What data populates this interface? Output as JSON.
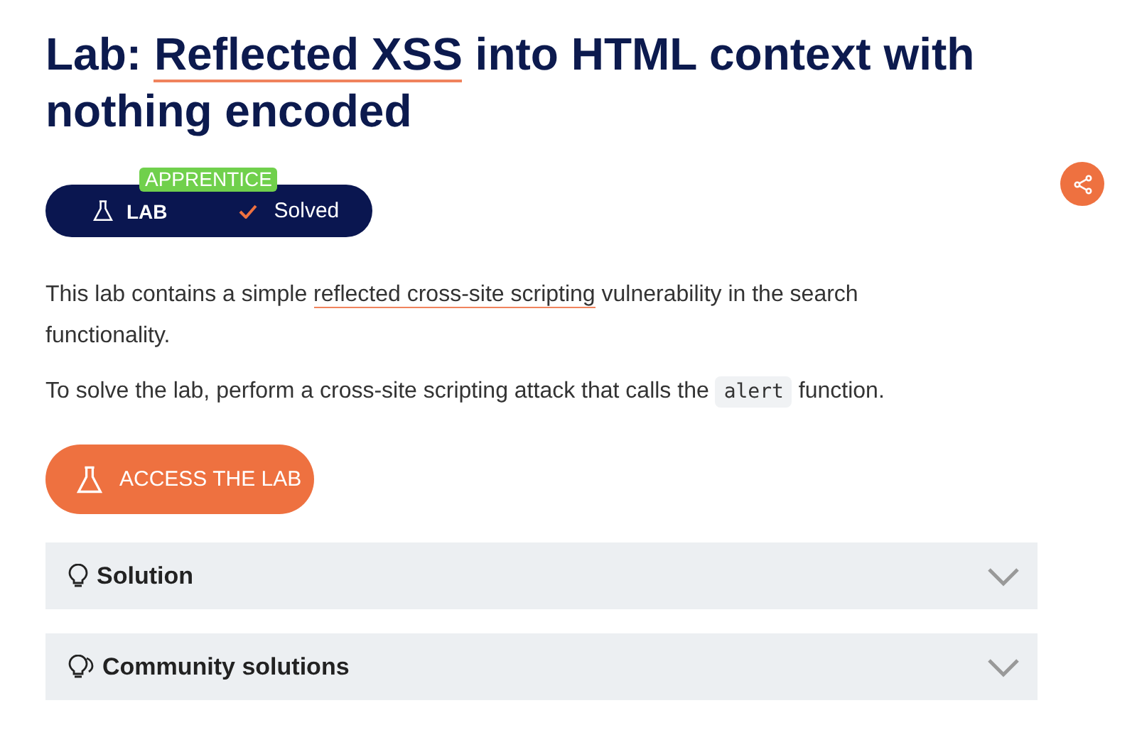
{
  "title": {
    "prefix": "Lab: ",
    "link": "Reflected XSS",
    "suffix": " into HTML context with nothing encoded"
  },
  "badge": {
    "level": "APPRENTICE",
    "type": "LAB",
    "status": "Solved"
  },
  "description": [
    {
      "before": "This lab contains a simple ",
      "link": "reflected cross-site scripting",
      "after": " vulnerability in the search functionality."
    },
    {
      "before": "To solve the lab, perform a cross-site scripting attack that calls the ",
      "code": "alert",
      "after": " function."
    }
  ],
  "access_button": "ACCESS THE LAB",
  "accordions": [
    {
      "kind": "single",
      "label": "Solution",
      "expanded": false
    },
    {
      "kind": "multi",
      "label": "Community solutions",
      "expanded": false
    }
  ]
}
